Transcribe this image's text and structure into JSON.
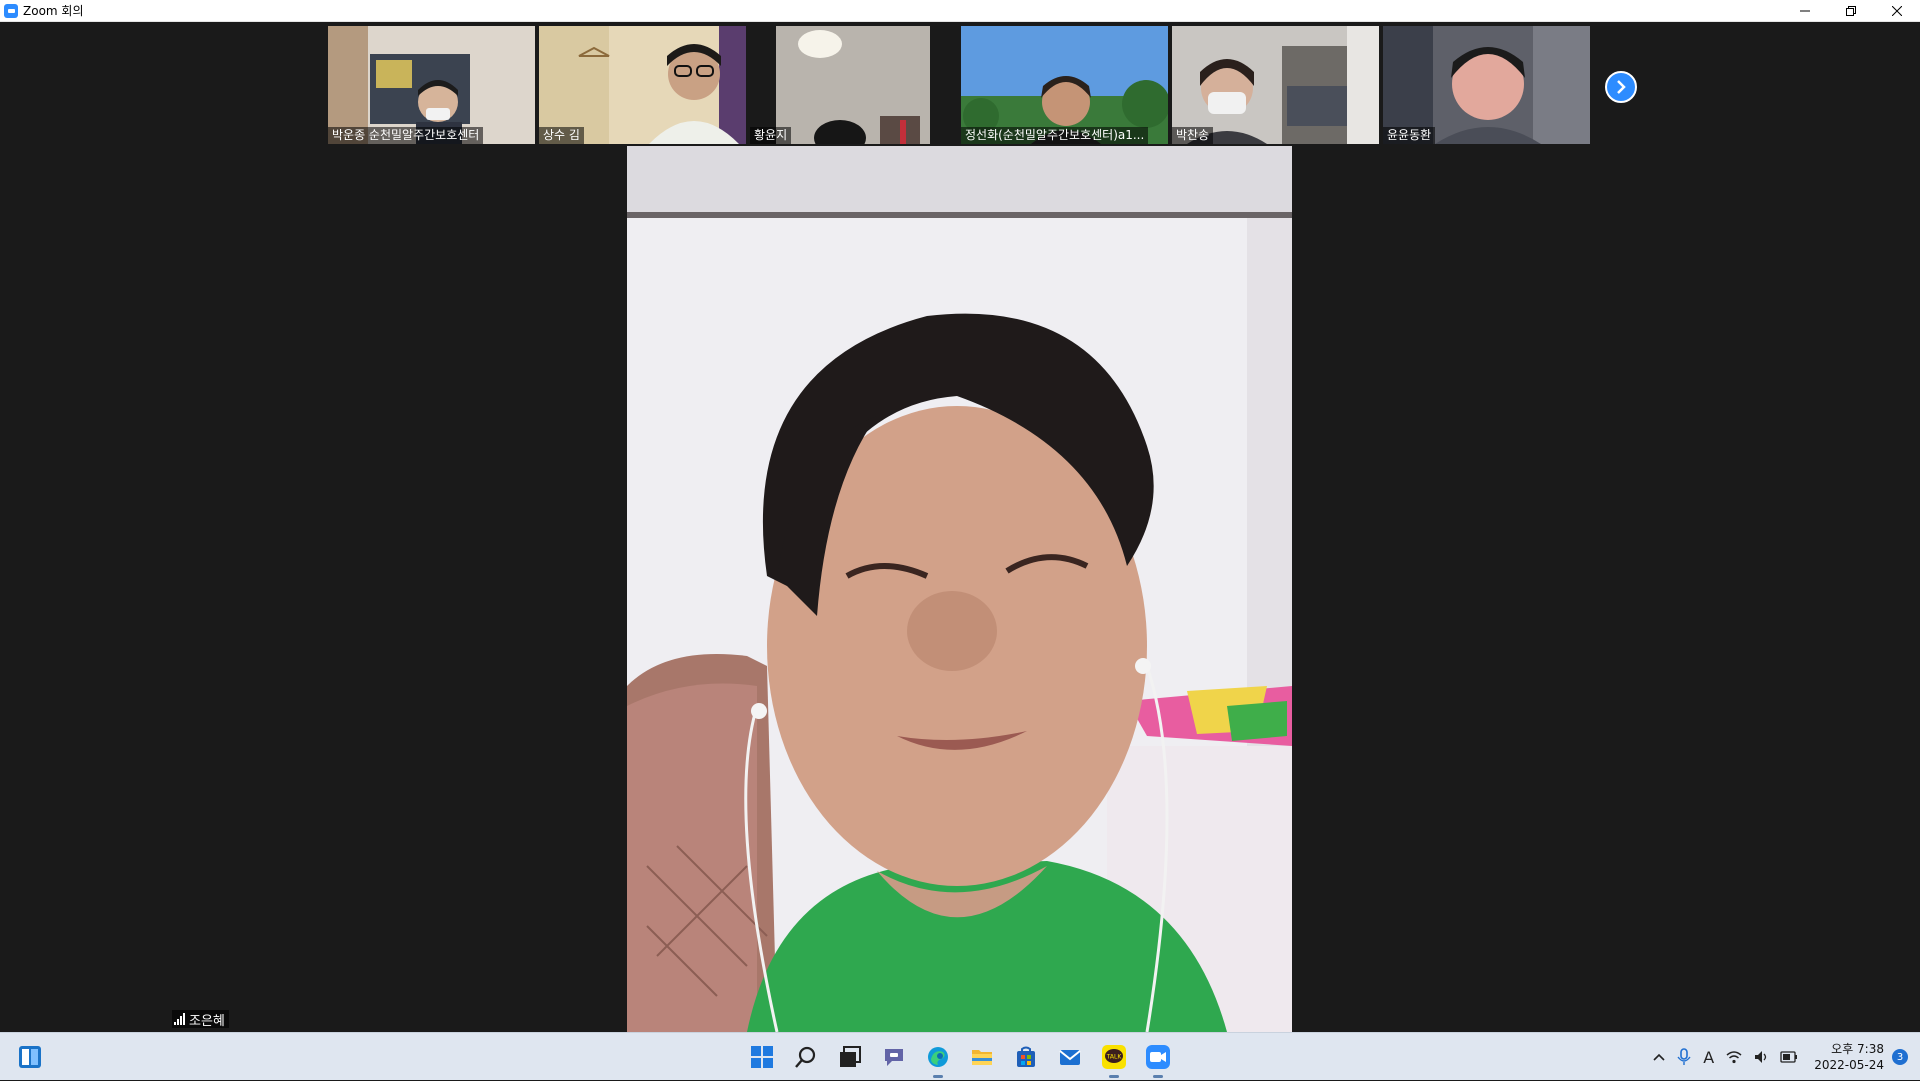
{
  "window": {
    "title": "Zoom 회의",
    "controls": {
      "minimize": "—",
      "restore": "❐",
      "close": "✕"
    }
  },
  "participants": [
    {
      "name": "박운종 순천밀알주간보호센터",
      "bg": "#b8a28a"
    },
    {
      "name": "상수 김",
      "bg": "#d8c9a8"
    },
    {
      "name": "황윤지",
      "bg": "#3a3633"
    },
    {
      "name": "정선화(순천밀알주간보호센터)a1...",
      "bg": "#5b95d6"
    },
    {
      "name": "박찬송",
      "bg": "#8f8a84"
    },
    {
      "name": "윤윤동환",
      "bg": "#5b5d66"
    }
  ],
  "main_speaker": {
    "name": "조은혜"
  },
  "taskbar": {
    "apps": [
      "windows-start-icon",
      "search-icon",
      "task-view-icon",
      "teams-chat-icon",
      "edge-icon",
      "file-explorer-icon",
      "ms-store-icon",
      "mail-icon",
      "kakaotalk-icon",
      "zoom-icon"
    ],
    "kakao_label": "TALK",
    "tray": {
      "chevron": "^",
      "input_method": "A"
    },
    "clock_time": "오후 7:38",
    "clock_date": "2022-05-24",
    "notifications": "3"
  },
  "colors": {
    "zoom_blue": "#2d8cff",
    "stage": "#1a1a1a",
    "taskbar": "#dfe6f0"
  }
}
